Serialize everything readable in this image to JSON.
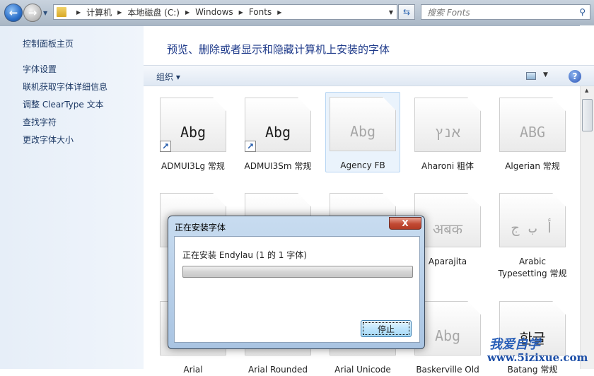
{
  "address": {
    "crumbs": [
      "计算机",
      "本地磁盘 (C:)",
      "Windows",
      "Fonts"
    ]
  },
  "search": {
    "placeholder": "搜索 Fonts"
  },
  "sidebar": {
    "items": [
      {
        "label": "控制面板主页"
      },
      {
        "label": "字体设置"
      },
      {
        "label": "联机获取字体详细信息"
      },
      {
        "label": "调整 ClearType 文本"
      },
      {
        "label": "查找字符"
      },
      {
        "label": "更改字体大小"
      }
    ]
  },
  "main": {
    "title": "预览、删除或者显示和隐藏计算机上安装的字体",
    "toolbar": {
      "organize": "组织 ▾"
    },
    "fonts": [
      {
        "label": "ADMUI3Lg 常规",
        "glyph": "Abg",
        "shortcut": true
      },
      {
        "label": "ADMUI3Sm 常规",
        "glyph": "Abg",
        "shortcut": true
      },
      {
        "label": "Agency FB",
        "glyph": "Abg",
        "selected": true,
        "faded": true
      },
      {
        "label": "Aharoni 粗体",
        "glyph": "אנץ",
        "faded": true
      },
      {
        "label": "Algerian 常规",
        "glyph": "ABG",
        "faded": true
      },
      {
        "label": "",
        "glyph": ""
      },
      {
        "label": "",
        "glyph": ""
      },
      {
        "label": "",
        "glyph": ""
      },
      {
        "label": "Aparajita",
        "glyph": "अबक",
        "faded": true
      },
      {
        "label": "Arabic Typesetting 常规",
        "glyph": "أ ب ج",
        "faded": true
      },
      {
        "label": "Arial",
        "glyph": ""
      },
      {
        "label": "Arial Rounded",
        "glyph": ""
      },
      {
        "label": "Arial Unicode",
        "glyph": ""
      },
      {
        "label": "Baskerville Old",
        "glyph": "Abg",
        "faded": true
      },
      {
        "label": "Batang 常规",
        "glyph": "한글"
      }
    ]
  },
  "dialog": {
    "title": "正在安装字体",
    "close": "X",
    "message": "正在安装 Endylau (1 的 1 字体)",
    "progress_percent": 0,
    "stop": "停止"
  },
  "watermark": {
    "line1": "我爱自学",
    "line2": "www.5izixue.com"
  }
}
